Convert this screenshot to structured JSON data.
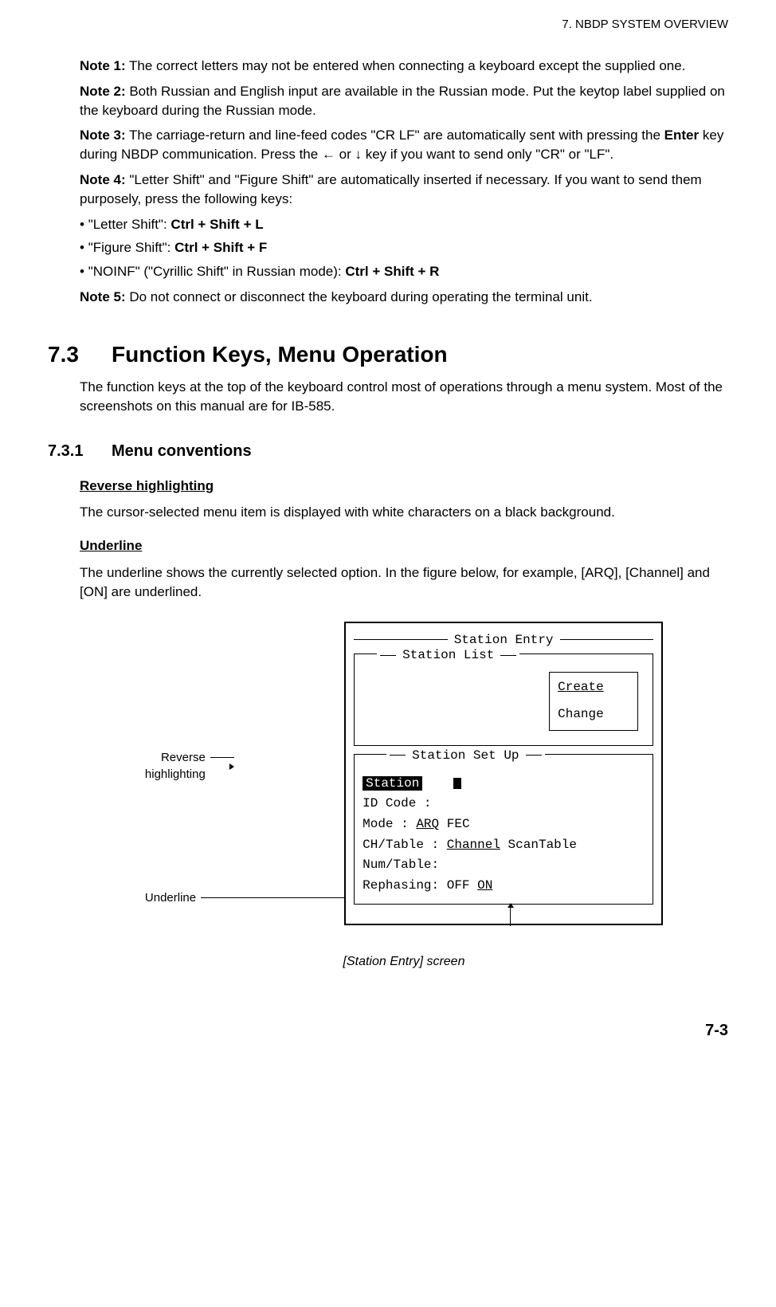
{
  "header": "7.  NBDP SYSTEM OVERVIEW",
  "notes": {
    "n1_label": "Note 1:",
    "n1_text": " The correct letters may not be entered when connecting a keyboard except the supplied one.",
    "n2_label": "Note 2:",
    "n2_text": " Both Russian and English input are available in the Russian mode. Put the keytop label supplied on the keyboard during the Russian mode.",
    "n3_label": "Note 3:",
    "n3_a": " The carriage-return and line-feed codes \"CR LF\" are automatically sent with pressing the ",
    "n3_enter": "Enter",
    "n3_b": " key during NBDP communication. Press the ← or ↓ key if you want to send only \"CR\" or \"LF\".",
    "n4_label": "Note 4:",
    "n4_text": " \"Letter Shift\" and \"Figure Shift\" are automatically inserted if necessary. If you want to send them purposely, press the following keys:",
    "b1_a": "\"Letter Shift\": ",
    "b1_k": "Ctrl + Shift + L",
    "b2_a": "\"Figure Shift\": ",
    "b2_k": "Ctrl + Shift + F",
    "b3_a": "\"NOINF\" (\"Cyrillic Shift\" in Russian mode): ",
    "b3_k": "Ctrl + Shift + R",
    "n5_label": "Note 5:",
    "n5_text": " Do not connect or disconnect the keyboard during operating the terminal unit."
  },
  "sec": {
    "num": "7.3",
    "title": "Function Keys, Menu Operation",
    "intro": "The function keys at the top of the keyboard control most of operations through a menu system. Most of the screenshots on this manual are for IB-585."
  },
  "sub": {
    "num": "7.3.1",
    "title": "Menu conventions",
    "rev_head": "Reverse highlighting",
    "rev_text": "The cursor-selected menu item is displayed with white characters on a black background.",
    "und_head": "Underline",
    "und_text": "The underline shows the currently selected option. In the figure below, for example, [ARQ], [Channel] and [ON] are underlined."
  },
  "callouts": {
    "rev1": "Reverse",
    "rev2": "highlighting",
    "und": "Underline"
  },
  "screen": {
    "entry": "Station Entry",
    "list": "Station List",
    "create": "Create",
    "change": "Change",
    "setup": "Station Set Up",
    "station": "Station",
    "id": "ID Code  :",
    "mode_lbl": "Mode     : ",
    "mode_arq": "ARQ",
    "mode_fec": " FEC",
    "ch_lbl": "CH/Table : ",
    "ch_channel": "Channel",
    "ch_scan": " ScanTable",
    "num": "Num/Table:",
    "rep_lbl": "Rephasing: OFF ",
    "rep_on": "ON"
  },
  "caption": "[Station Entry] screen",
  "page": "7-3"
}
